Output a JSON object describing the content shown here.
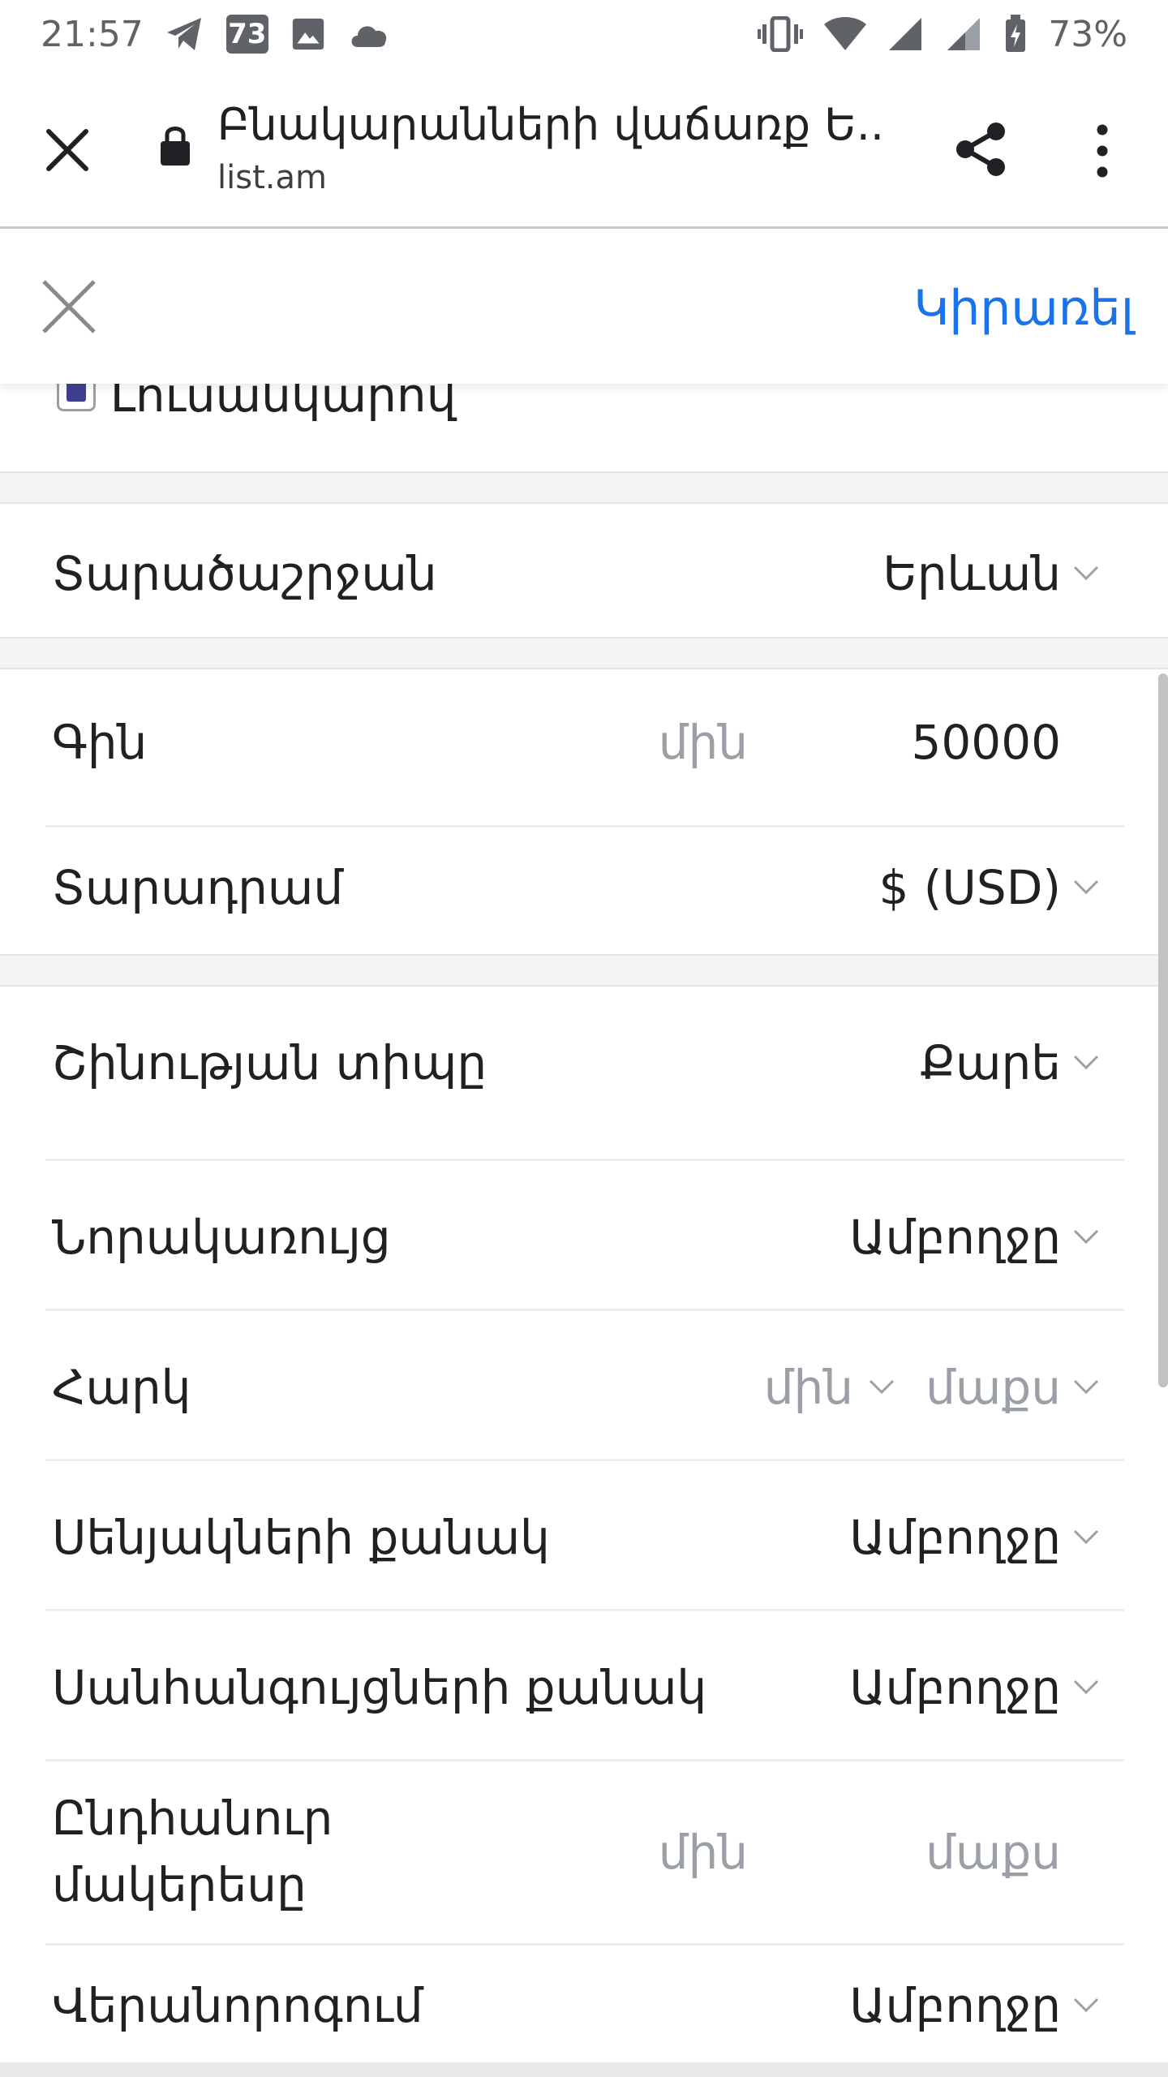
{
  "status_bar": {
    "time": "21:57",
    "notification_count": "73",
    "battery": "73%"
  },
  "browser": {
    "title": "Բնակարանների վաճառք Ե...",
    "url": "list.am"
  },
  "filter": {
    "apply_label": "Կիրառել",
    "photo_label": "Լուսանկարով",
    "region": {
      "label": "Տարածաշրջան",
      "value": "Երևան"
    },
    "price": {
      "label": "Գին",
      "min_placeholder": "մին",
      "max_value": "50000"
    },
    "currency": {
      "label": "Տարադրամ",
      "value": "$ (USD)"
    },
    "building_type": {
      "label": "Շինության տիպը",
      "value": "Քարե"
    },
    "new_construction": {
      "label": "Նորակառույց",
      "value": "Ամբողջը"
    },
    "floor": {
      "label": "Հարկ",
      "min_placeholder": "մին",
      "max_placeholder": "մաքս"
    },
    "rooms": {
      "label": "Սենյակների քանակ",
      "value": "Ամբողջը"
    },
    "bathrooms": {
      "label": "Սանհանգույցների քանակ",
      "value": "Ամբողջը"
    },
    "total_area": {
      "label_line1": "Ընդհանուր",
      "label_line2": "մակերեսը",
      "min_placeholder": "մին",
      "max_placeholder": "մաքս"
    },
    "renovation": {
      "label": "Վերանորոգում",
      "value": "Ամբողջը"
    }
  },
  "colors": {
    "accent": "#1a73e8",
    "text": "#202124",
    "muted": "#9aa0a6",
    "checkbox_fill": "#3f3f8f"
  }
}
